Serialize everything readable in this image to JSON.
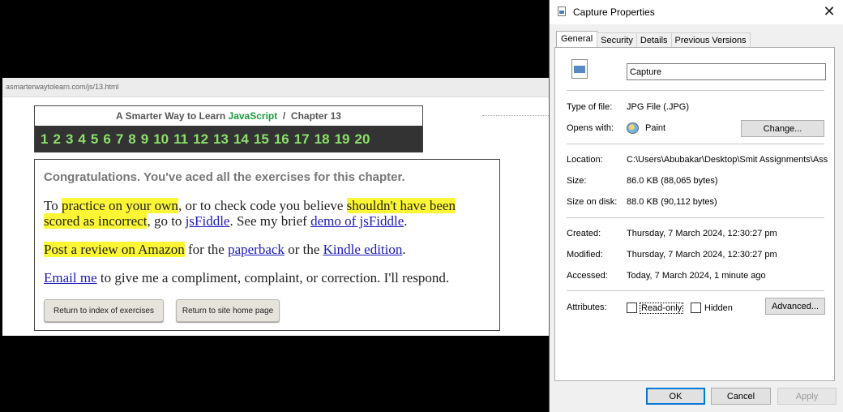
{
  "browser": {
    "url": "asmarterwaytolearn.com/js/13.html"
  },
  "page": {
    "header": {
      "title_prefix": "A Smarter Way to Learn ",
      "title_js": "JavaScript",
      "title_suffix": "  /  Chapter 13",
      "chapters": [
        "1",
        "2",
        "3",
        "4",
        "5",
        "6",
        "7",
        "8",
        "9",
        "10",
        "11",
        "12",
        "13",
        "14",
        "15",
        "16",
        "17",
        "18",
        "19",
        "20"
      ]
    },
    "congrats": "Congratulations. You've aced all the exercises for this chapter.",
    "p1": {
      "t1": "To ",
      "hl1": "practice on your own",
      "t2": ", or to check code you believe ",
      "hl2": "shouldn't have been scored as incorrect",
      "t3": ", go to ",
      "link1": "jsFiddle",
      "t4": ". See my brief ",
      "link2": "demo of jsFiddle",
      "t5": "."
    },
    "p2": {
      "hl": "Post a review on Amazon",
      "t1": " for the ",
      "link1": "paperback",
      "t2": " or the ",
      "link2": "Kindle edition",
      "t3": "."
    },
    "p3": {
      "link": "Email me",
      "t1": " to give me a compliment, complaint, or correction. I'll respond."
    },
    "buttons": {
      "index": "Return to index of exercises",
      "home": "Return to site home page"
    }
  },
  "dialog": {
    "title": "Capture Properties",
    "tabs": [
      "General",
      "Security",
      "Details",
      "Previous Versions"
    ],
    "active_tab": "General",
    "file_name": "Capture",
    "type_label": "Type of file:",
    "type_value": "JPG File (.JPG)",
    "opens_label": "Opens with:",
    "opens_value": "Paint",
    "change_button": "Change...",
    "location_label": "Location:",
    "location_value": "C:\\Users\\Abubakar\\Desktop\\Smit Assignments\\Ass",
    "size_label": "Size:",
    "size_value": "86.0 KB (88,065 bytes)",
    "size_disk_label": "Size on disk:",
    "size_disk_value": "88.0 KB (90,112 bytes)",
    "created_label": "Created:",
    "created_value": "Thursday, 7 March 2024, 12:30:27 pm",
    "modified_label": "Modified:",
    "modified_value": "Thursday, 7 March 2024, 12:30:27 pm",
    "accessed_label": "Accessed:",
    "accessed_value": "Today, 7 March 2024, 1 minute ago",
    "attributes_label": "Attributes:",
    "readonly_label": "Read-only",
    "hidden_label": "Hidden",
    "advanced_button": "Advanced...",
    "ok_button": "OK",
    "cancel_button": "Cancel",
    "apply_button": "Apply"
  }
}
